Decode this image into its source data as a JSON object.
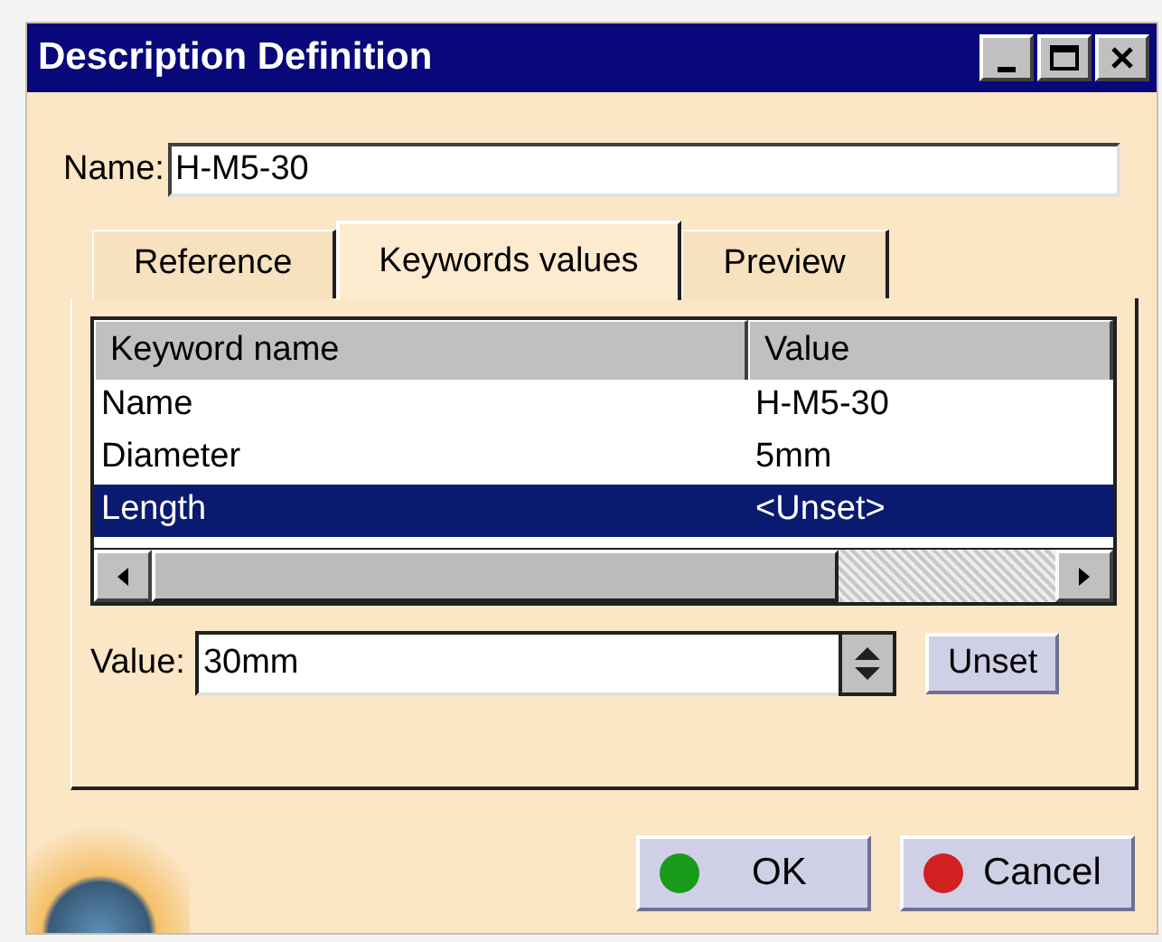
{
  "window": {
    "title": "Description Definition"
  },
  "name_field": {
    "label": "Name:",
    "value": "H-M5-30"
  },
  "tabs": [
    {
      "label": "Reference",
      "selected": false
    },
    {
      "label": "Keywords values",
      "selected": true
    },
    {
      "label": "Preview",
      "selected": false
    }
  ],
  "table": {
    "columns": [
      "Keyword name",
      "Value"
    ],
    "rows": [
      {
        "cells": [
          "Name",
          "H-M5-30"
        ],
        "selected": false
      },
      {
        "cells": [
          "Diameter",
          "5mm"
        ],
        "selected": false
      },
      {
        "cells": [
          "Length",
          "<Unset>"
        ],
        "selected": true
      }
    ]
  },
  "value_field": {
    "label": "Value:",
    "value": "30mm"
  },
  "unset_button": "Unset",
  "buttons": [
    {
      "kind": "ok",
      "label": "OK"
    },
    {
      "kind": "cancel",
      "label": "Cancel"
    }
  ]
}
